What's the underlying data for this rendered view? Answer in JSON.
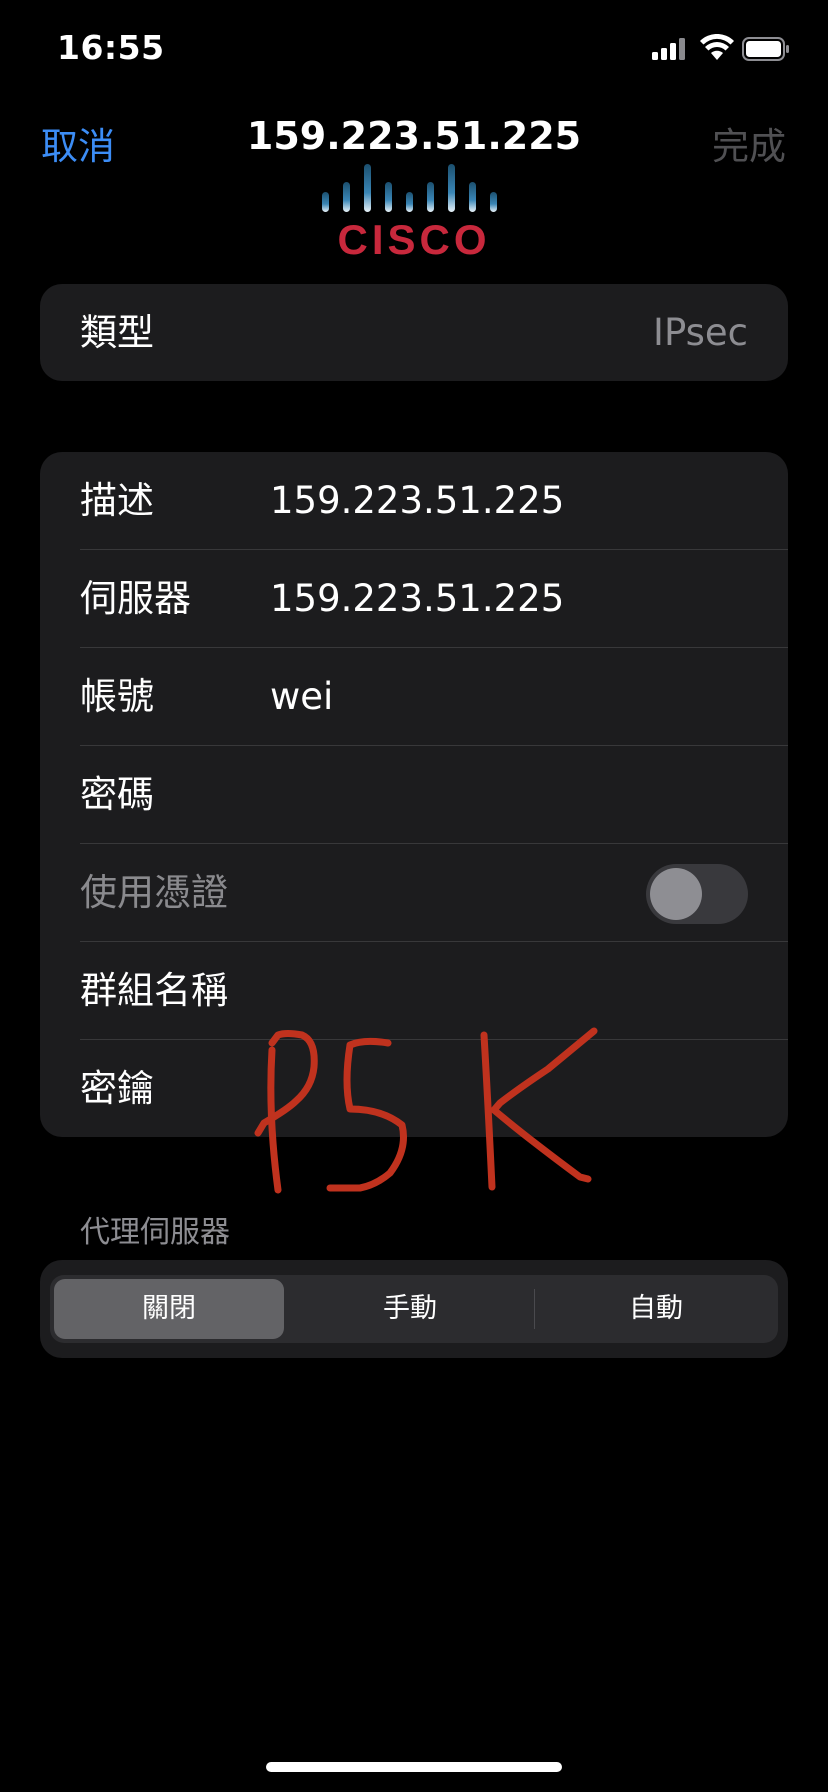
{
  "status_bar": {
    "time": "16:55"
  },
  "nav": {
    "cancel": "取消",
    "title": "159.223.51.225",
    "done": "完成"
  },
  "logo": {
    "text": "CISCO"
  },
  "type_row": {
    "label": "類型",
    "value": "IPsec"
  },
  "fields": {
    "description": {
      "label": "描述",
      "value": "159.223.51.225"
    },
    "server": {
      "label": "伺服器",
      "value": "159.223.51.225"
    },
    "account": {
      "label": "帳號",
      "value": "wei"
    },
    "password": {
      "label": "密碼",
      "value": ""
    },
    "use_certificate": {
      "label": "使用憑證",
      "enabled": false
    },
    "group_name": {
      "label": "群組名稱",
      "value": ""
    },
    "secret": {
      "label": "密鑰",
      "value": ""
    }
  },
  "proxy": {
    "header": "代理伺服器",
    "options": [
      "關閉",
      "手動",
      "自動"
    ],
    "selected": "關閉"
  },
  "annotation": {
    "text": "PSK",
    "color": "#c0321e"
  },
  "colors": {
    "accent": "#3c8df6",
    "background": "#000000",
    "cell": "#1c1c1e",
    "cisco_red": "#c8283c",
    "cisco_blue": "#3a86b6"
  }
}
